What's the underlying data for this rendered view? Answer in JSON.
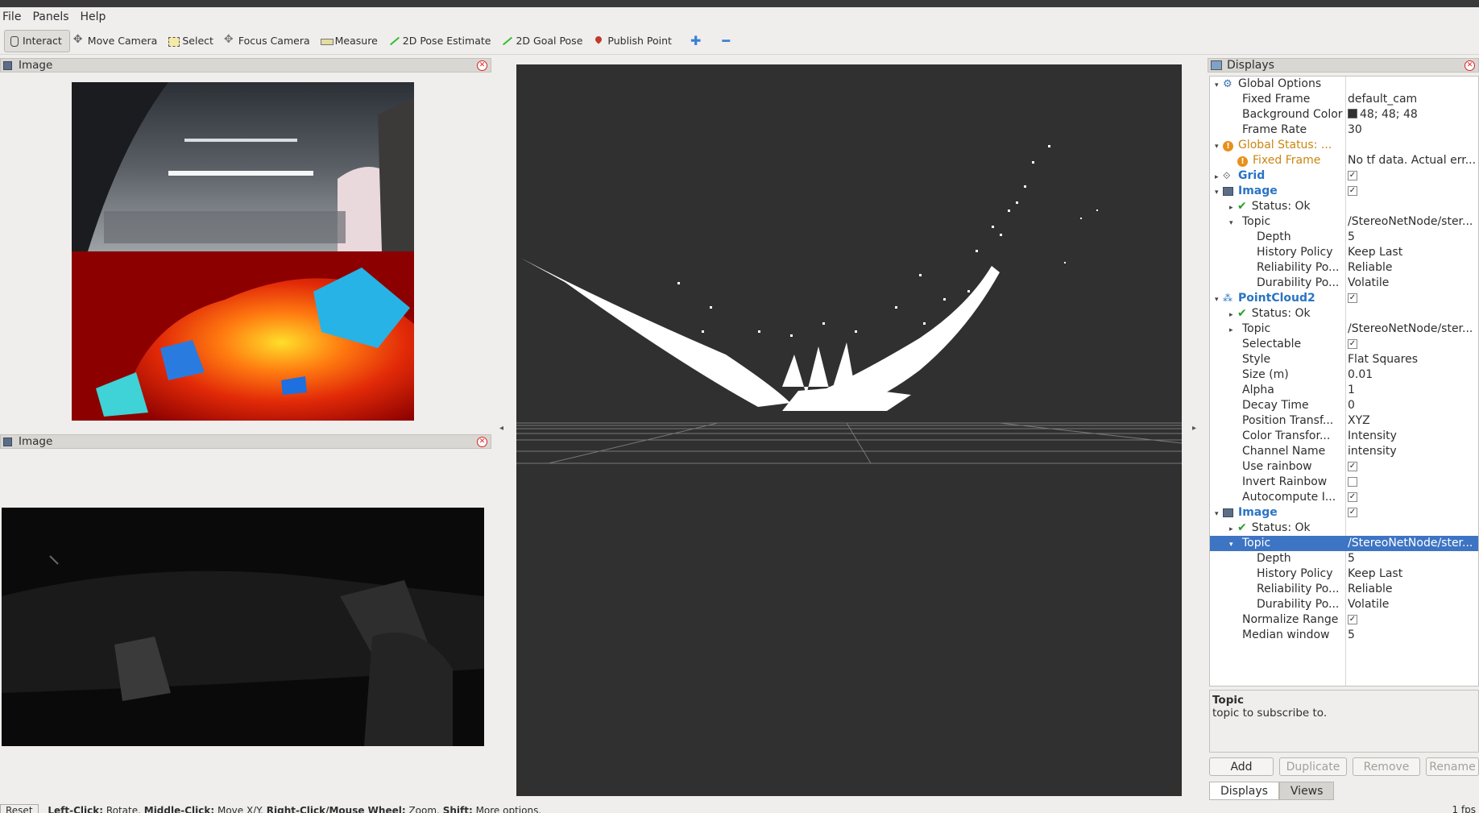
{
  "menu": {
    "items": [
      "File",
      "Panels",
      "Help"
    ]
  },
  "toolbar": {
    "tools": [
      {
        "label": "Interact",
        "icon": "hand-icon",
        "active": true
      },
      {
        "label": "Move Camera",
        "icon": "move-camera-icon"
      },
      {
        "label": "Select",
        "icon": "select-icon"
      },
      {
        "label": "Focus Camera",
        "icon": "focus-camera-icon"
      },
      {
        "label": "Measure",
        "icon": "measure-icon"
      },
      {
        "label": "2D Pose Estimate",
        "icon": "pose-arrow-icon"
      },
      {
        "label": "2D Goal Pose",
        "icon": "goal-arrow-icon"
      },
      {
        "label": "Publish Point",
        "icon": "pin-icon"
      }
    ],
    "add_icon": "plus-icon",
    "remove_icon": "minus-icon"
  },
  "panels": {
    "image_top_title": "Image",
    "image_bottom_title": "Image"
  },
  "displays": {
    "title": "Displays",
    "rows": [
      {
        "indent": 0,
        "arrow": "▾",
        "icon": "gear",
        "name": "Global Options",
        "value": "",
        "style": ""
      },
      {
        "indent": 1,
        "arrow": "",
        "icon": "",
        "name": "Fixed Frame",
        "value": "default_cam",
        "style": ""
      },
      {
        "indent": 1,
        "arrow": "",
        "icon": "",
        "name": "Background Color",
        "value": "48; 48; 48",
        "style": "",
        "swatch": "#303030"
      },
      {
        "indent": 1,
        "arrow": "",
        "icon": "",
        "name": "Frame Rate",
        "value": "30",
        "style": ""
      },
      {
        "indent": 0,
        "arrow": "▾",
        "icon": "warn",
        "name": "Global Status: ...",
        "value": "",
        "style": "orange"
      },
      {
        "indent": 1,
        "arrow": "",
        "icon": "warn",
        "name": "Fixed Frame",
        "value": "No tf data.  Actual err...",
        "style": "orange"
      },
      {
        "indent": 0,
        "arrow": "▸",
        "icon": "grid",
        "name": "Grid",
        "value": "",
        "style": "blue",
        "check": true
      },
      {
        "indent": 0,
        "arrow": "▾",
        "icon": "image",
        "name": "Image",
        "value": "",
        "style": "blue",
        "check": true
      },
      {
        "indent": 1,
        "arrow": "▸",
        "icon": "tick",
        "name": "Status: Ok",
        "value": "",
        "style": ""
      },
      {
        "indent": 1,
        "arrow": "▾",
        "icon": "",
        "name": "Topic",
        "value": "/StereoNetNode/ster...",
        "style": ""
      },
      {
        "indent": 2,
        "arrow": "",
        "icon": "",
        "name": "Depth",
        "value": "5",
        "style": ""
      },
      {
        "indent": 2,
        "arrow": "",
        "icon": "",
        "name": "History Policy",
        "value": "Keep Last",
        "style": ""
      },
      {
        "indent": 2,
        "arrow": "",
        "icon": "",
        "name": "Reliability Po...",
        "value": "Reliable",
        "style": ""
      },
      {
        "indent": 2,
        "arrow": "",
        "icon": "",
        "name": "Durability Po...",
        "value": "Volatile",
        "style": ""
      },
      {
        "indent": 0,
        "arrow": "▾",
        "icon": "pc",
        "name": "PointCloud2",
        "value": "",
        "style": "blue",
        "check": true
      },
      {
        "indent": 1,
        "arrow": "▸",
        "icon": "tick",
        "name": "Status: Ok",
        "value": "",
        "style": ""
      },
      {
        "indent": 1,
        "arrow": "▸",
        "icon": "",
        "name": "Topic",
        "value": "/StereoNetNode/ster...",
        "style": ""
      },
      {
        "indent": 1,
        "arrow": "",
        "icon": "",
        "name": "Selectable",
        "value": "",
        "style": "",
        "check": true
      },
      {
        "indent": 1,
        "arrow": "",
        "icon": "",
        "name": "Style",
        "value": "Flat Squares",
        "style": ""
      },
      {
        "indent": 1,
        "arrow": "",
        "icon": "",
        "name": "Size (m)",
        "value": "0.01",
        "style": ""
      },
      {
        "indent": 1,
        "arrow": "",
        "icon": "",
        "name": "Alpha",
        "value": "1",
        "style": ""
      },
      {
        "indent": 1,
        "arrow": "",
        "icon": "",
        "name": "Decay Time",
        "value": "0",
        "style": ""
      },
      {
        "indent": 1,
        "arrow": "",
        "icon": "",
        "name": "Position Transf...",
        "value": "XYZ",
        "style": ""
      },
      {
        "indent": 1,
        "arrow": "",
        "icon": "",
        "name": "Color Transfor...",
        "value": "Intensity",
        "style": ""
      },
      {
        "indent": 1,
        "arrow": "",
        "icon": "",
        "name": "Channel Name",
        "value": "intensity",
        "style": ""
      },
      {
        "indent": 1,
        "arrow": "",
        "icon": "",
        "name": "Use rainbow",
        "value": "",
        "style": "",
        "check": true
      },
      {
        "indent": 1,
        "arrow": "",
        "icon": "",
        "name": "Invert Rainbow",
        "value": "",
        "style": "",
        "check": false
      },
      {
        "indent": 1,
        "arrow": "",
        "icon": "",
        "name": "Autocompute I...",
        "value": "",
        "style": "",
        "check": true
      },
      {
        "indent": 0,
        "arrow": "▾",
        "icon": "image",
        "name": "Image",
        "value": "",
        "style": "blue",
        "check": true
      },
      {
        "indent": 1,
        "arrow": "▸",
        "icon": "tick",
        "name": "Status: Ok",
        "value": "",
        "style": ""
      },
      {
        "indent": 1,
        "arrow": "▾",
        "icon": "",
        "name": "Topic",
        "value": "/StereoNetNode/ster...",
        "style": "",
        "selected": true
      },
      {
        "indent": 2,
        "arrow": "",
        "icon": "",
        "name": "Depth",
        "value": "5",
        "style": ""
      },
      {
        "indent": 2,
        "arrow": "",
        "icon": "",
        "name": "History Policy",
        "value": "Keep Last",
        "style": ""
      },
      {
        "indent": 2,
        "arrow": "",
        "icon": "",
        "name": "Reliability Po...",
        "value": "Reliable",
        "style": ""
      },
      {
        "indent": 2,
        "arrow": "",
        "icon": "",
        "name": "Durability Po...",
        "value": "Volatile",
        "style": ""
      },
      {
        "indent": 1,
        "arrow": "",
        "icon": "",
        "name": "Normalize Range",
        "value": "",
        "style": "",
        "check": true
      },
      {
        "indent": 1,
        "arrow": "",
        "icon": "",
        "name": "Median window",
        "value": "5",
        "style": ""
      }
    ]
  },
  "help": {
    "title": "Topic",
    "text": "topic to subscribe to."
  },
  "buttons": {
    "add": "Add",
    "duplicate": "Duplicate",
    "remove": "Remove",
    "rename": "Rename"
  },
  "tabs": {
    "displays": "Displays",
    "views": "Views"
  },
  "status": {
    "reset": "Reset",
    "hint_parts": [
      "Left-Click:",
      " Rotate. ",
      "Middle-Click:",
      " Move X/Y. ",
      "Right-Click/Mouse Wheel:",
      " Zoom. ",
      "Shift:",
      " More options."
    ],
    "fps": "1 fps"
  },
  "colors": {
    "render_bg": "#303030",
    "selection": "#3d74c4",
    "link_blue": "#2a74c4",
    "warn_orange": "#c8860f"
  }
}
